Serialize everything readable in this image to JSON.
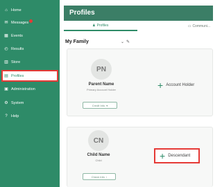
{
  "sidebar": {
    "items": [
      {
        "label": "Home",
        "icon": "home-icon",
        "glyph": "⌂"
      },
      {
        "label": "Messages",
        "icon": "message-icon",
        "glyph": "✉",
        "badge": true
      },
      {
        "label": "Events",
        "icon": "calendar-icon",
        "glyph": "▦"
      },
      {
        "label": "Results",
        "icon": "results-icon",
        "glyph": "◴"
      },
      {
        "label": "Store",
        "icon": "store-icon",
        "glyph": "▥"
      },
      {
        "label": "Profiles",
        "icon": "profile-icon",
        "glyph": "▤",
        "active": true
      },
      {
        "label": "Administration",
        "icon": "admin-icon",
        "glyph": "▣"
      },
      {
        "label": "System",
        "icon": "system-icon",
        "glyph": "⚙"
      },
      {
        "label": "Help",
        "icon": "help-icon",
        "glyph": "?"
      }
    ]
  },
  "header": {
    "title": "Profiles"
  },
  "tabs": [
    {
      "label": "Profiles",
      "icon": "user-icon",
      "glyph": "♟"
    },
    {
      "label": "Communi...",
      "icon": "chat-icon",
      "glyph": "▭"
    }
  ],
  "family": {
    "title": "My Family",
    "caret": "⌄",
    "edit": "✎"
  },
  "parent": {
    "initials": "PN",
    "name": "Parent Name",
    "sub": "Primary Account Holder",
    "button": "Credit Info",
    "button_icon": "▾",
    "action": "Account Holder",
    "plus": "+"
  },
  "child": {
    "initials": "CN",
    "name": "Child Name",
    "sub": "Child",
    "button": "Check Info",
    "button_icon": "›",
    "action": "Descendant",
    "plus": "+"
  },
  "colors": {
    "sidebar": "#2e8b68",
    "header": "#3b7e66",
    "highlight": "#e53935"
  }
}
